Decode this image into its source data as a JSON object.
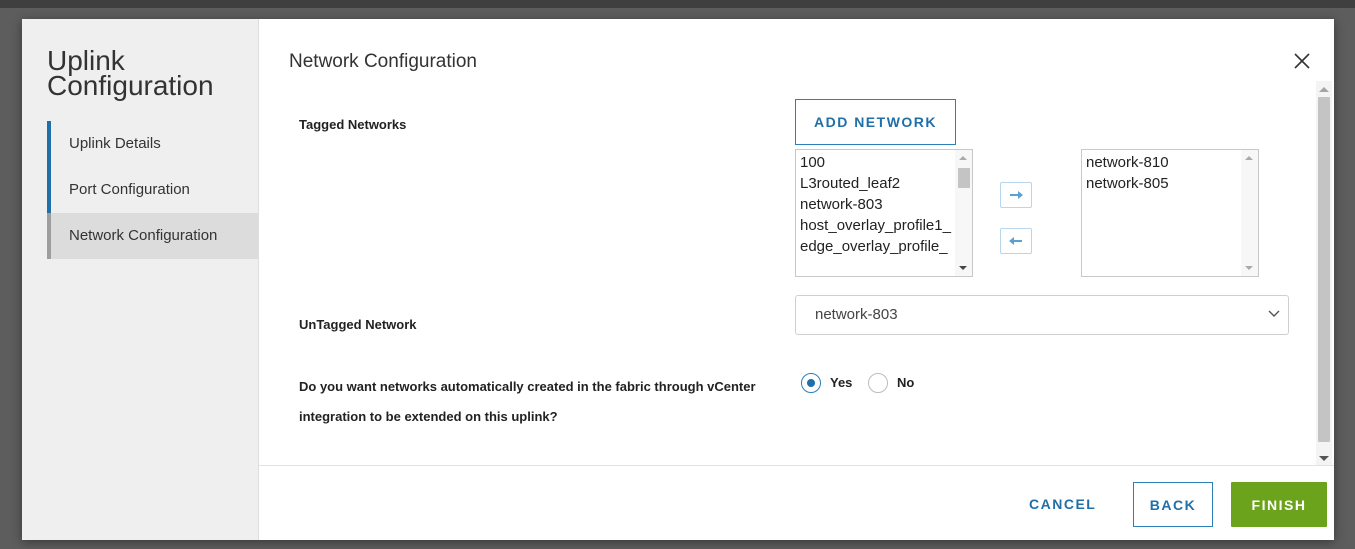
{
  "wizard": {
    "title": "Uplink Configuration",
    "steps": [
      {
        "label": "Uplink Details",
        "state": "done"
      },
      {
        "label": "Port Configuration",
        "state": "done"
      },
      {
        "label": "Network Configuration",
        "state": "active"
      }
    ]
  },
  "page": {
    "title": "Network Configuration",
    "close_icon": "close-icon"
  },
  "tagged_networks": {
    "label": "Tagged Networks",
    "add_button": "ADD NETWORK",
    "available": [
      "100",
      "L3routed_leaf2",
      "network-803",
      "host_overlay_profile1_",
      "edge_overlay_profile_"
    ],
    "selected": [
      "network-810",
      "network-805"
    ],
    "move_right_icon": "arrow-right-icon",
    "move_left_icon": "arrow-left-icon"
  },
  "untagged_network": {
    "label": "UnTagged Network",
    "value": "network-803",
    "chevron_icon": "chevron-down-icon"
  },
  "extend_question": {
    "label": "Do you want networks automatically created in the fabric through vCenter integration to be extended on this uplink?",
    "options": [
      "Yes",
      "No"
    ],
    "selected": "Yes"
  },
  "footer": {
    "cancel": "CANCEL",
    "back": "BACK",
    "finish": "FINISH"
  },
  "colors": {
    "accent": "#1f6fa8",
    "finish": "#6ba31c",
    "sidebar": "#efefef"
  }
}
